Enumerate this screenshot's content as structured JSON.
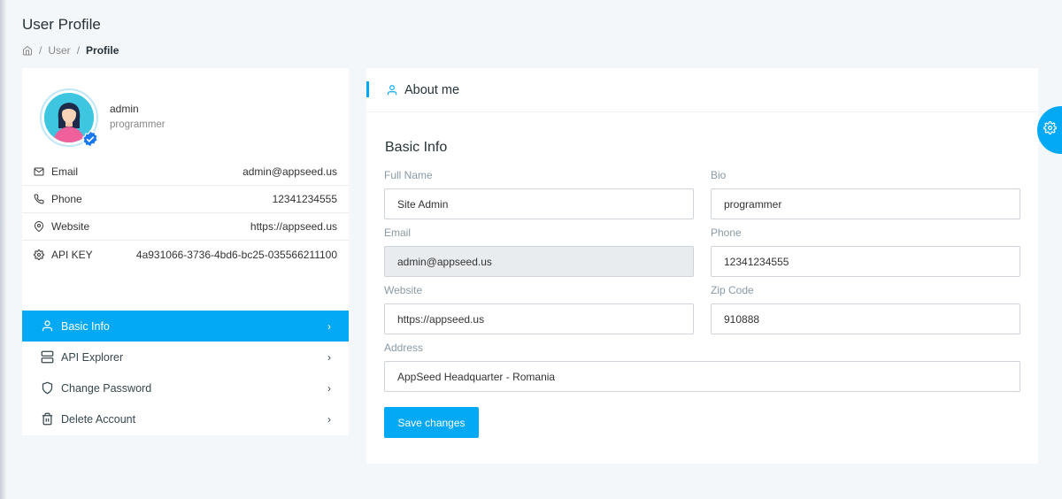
{
  "page": {
    "title": "User Profile",
    "breadcrumb": [
      "User",
      "Profile"
    ]
  },
  "profile": {
    "name": "admin",
    "role": "programmer",
    "info": [
      {
        "icon": "mail-icon",
        "label": "Email",
        "value": "admin@appseed.us"
      },
      {
        "icon": "phone-icon",
        "label": "Phone",
        "value": "12341234555"
      },
      {
        "icon": "map-pin-icon",
        "label": "Website",
        "value": "https://appseed.us"
      },
      {
        "icon": "key-icon",
        "label": "API KEY",
        "value": "4a931066-3736-4bd6-bc25-035566211100"
      }
    ]
  },
  "menu": [
    {
      "icon": "user-icon",
      "label": "Basic Info",
      "active": true
    },
    {
      "icon": "server-icon",
      "label": "API Explorer",
      "active": false
    },
    {
      "icon": "shield-icon",
      "label": "Change Password",
      "active": false
    },
    {
      "icon": "trash-icon",
      "label": "Delete Account",
      "active": false
    }
  ],
  "about": {
    "header": "About me",
    "section_title": "Basic Info",
    "fields": {
      "full_name": {
        "label": "Full Name",
        "value": "Site Admin"
      },
      "bio": {
        "label": "Bio",
        "value": "programmer"
      },
      "email": {
        "label": "Email",
        "value": "admin@appseed.us",
        "disabled": true
      },
      "phone": {
        "label": "Phone",
        "value": "12341234555"
      },
      "website": {
        "label": "Website",
        "value": "https://appseed.us"
      },
      "zip": {
        "label": "Zip Code",
        "value": "910888"
      },
      "address": {
        "label": "Address",
        "value": "AppSeed Headquarter - Romania"
      }
    },
    "save_label": "Save changes"
  },
  "colors": {
    "accent": "#04a9f5",
    "background": "#f4f7fa"
  }
}
